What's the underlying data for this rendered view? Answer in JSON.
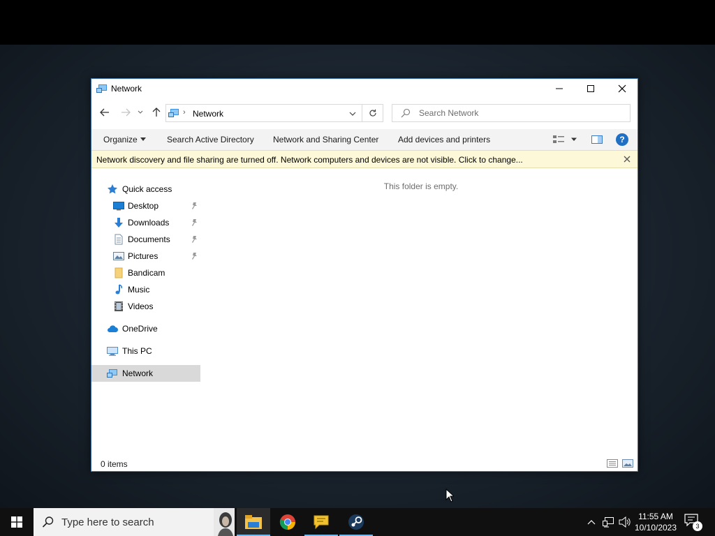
{
  "window": {
    "title": "Network",
    "controls": {
      "minimize": "minimize",
      "maximize": "maximize",
      "close": "close"
    }
  },
  "address": {
    "path": "Network",
    "search_placeholder": "Search Network"
  },
  "commandbar": {
    "organize": "Organize",
    "search_active_directory": "Search Active Directory",
    "network_sharing_center": "Network and Sharing Center",
    "add_devices": "Add devices and printers",
    "help": "?"
  },
  "infobar": {
    "message": "Network discovery and file sharing are turned off. Network computers and devices are not visible. Click to change..."
  },
  "navpane": {
    "quick_access": "Quick access",
    "items": [
      {
        "label": "Desktop",
        "icon": "desktop-icon",
        "pinned": true
      },
      {
        "label": "Downloads",
        "icon": "downloads-icon",
        "pinned": true
      },
      {
        "label": "Documents",
        "icon": "documents-icon",
        "pinned": true
      },
      {
        "label": "Pictures",
        "icon": "pictures-icon",
        "pinned": true
      },
      {
        "label": "Bandicam",
        "icon": "folder-icon",
        "pinned": false
      },
      {
        "label": "Music",
        "icon": "music-icon",
        "pinned": false
      },
      {
        "label": "Videos",
        "icon": "videos-icon",
        "pinned": false
      }
    ],
    "onedrive": "OneDrive",
    "this_pc": "This PC",
    "network": "Network"
  },
  "content": {
    "empty_message": "This folder is empty."
  },
  "statusbar": {
    "count": "0 items"
  },
  "taskbar": {
    "search_placeholder": "Type here to search",
    "apps": [
      "File Explorer",
      "Google Chrome",
      "Messenger",
      "Steam"
    ],
    "time": "11:55 AM",
    "date": "10/10/2023",
    "notification_count": "3"
  },
  "colors": {
    "accent": "#1f6fc5",
    "infobar": "#fdf8d8",
    "taskbar": "#101010",
    "selected": "#d9d9d9"
  }
}
